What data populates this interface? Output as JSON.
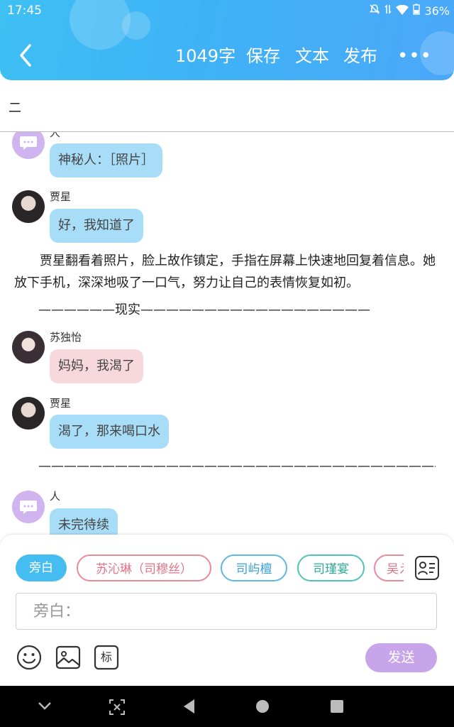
{
  "status": {
    "time": "17:45",
    "battery": "36%"
  },
  "header": {
    "word_count": "1049字",
    "save": "保存",
    "text": "文本",
    "publish": "发布",
    "more": "•••"
  },
  "chapter": {
    "title": "二"
  },
  "messages": [
    {
      "speaker": "人",
      "text": "神秘人：［照片］",
      "style": "blue"
    },
    {
      "speaker": "贾星",
      "text": "好，我知道了",
      "style": "blue"
    },
    {
      "narration": "贾星翻看着照片，脸上故作镇定，手指在屏幕上快速地回复着信息。她放下手机，深深地吸了一口气，努力让自己的表情恢复如初。"
    },
    {
      "separator": "——————现实——————————————————"
    },
    {
      "speaker": "苏独怡",
      "text": "妈妈，我渴了",
      "style": "pink"
    },
    {
      "speaker": "贾星",
      "text": "渴了，那来喝口水",
      "style": "blue"
    },
    {
      "separator": "———————————————————————————————————"
    },
    {
      "speaker": "人",
      "text": "未完待续",
      "style": "blue"
    }
  ],
  "roles": [
    "旁白",
    "苏沁琳（司穆丝）",
    "司屿檀",
    "司瑾宴",
    "吴え"
  ],
  "input": {
    "placeholder": "旁白："
  },
  "toolbar": {
    "tag": "标",
    "send": "发送"
  },
  "colors": {
    "header_start": "#3ec0f3",
    "header_end": "#4aa8f8",
    "send": "#c8a4ea",
    "chip_active": "#46bdf1"
  }
}
